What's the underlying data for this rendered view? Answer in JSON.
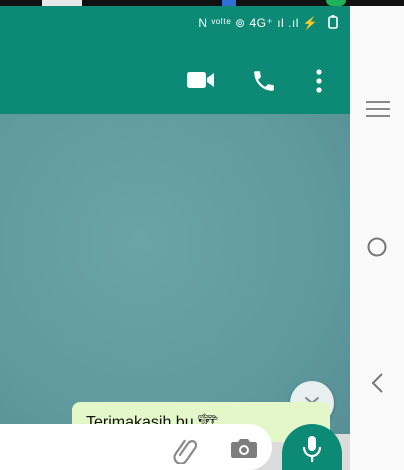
{
  "status_bar": {
    "indicators": "N ᵛᵒˡᵗᵉ ⊚ 4G⁺ ıl .ıl",
    "charging_icon": "lightning-bolt",
    "battery_icon": "battery-outline"
  },
  "app_bar": {
    "background_color": "#0c8a75",
    "actions": [
      {
        "name": "video-call",
        "icon": "video-camera-icon"
      },
      {
        "name": "voice-call",
        "icon": "phone-icon"
      },
      {
        "name": "more-options",
        "icon": "more-vertical-icon"
      }
    ]
  },
  "chat": {
    "wallpaper_color": "#5f9b9f",
    "last_message_text": "Terimakasih bu 🏗"
  },
  "composer": {
    "attach_icon": "paperclip-icon",
    "camera_icon": "camera-icon",
    "send_icon": "microphone-icon"
  },
  "nav": {
    "menu_icon": "menu-icon",
    "home_icon": "home-circle-icon",
    "back_icon": "back-chevron-icon"
  }
}
